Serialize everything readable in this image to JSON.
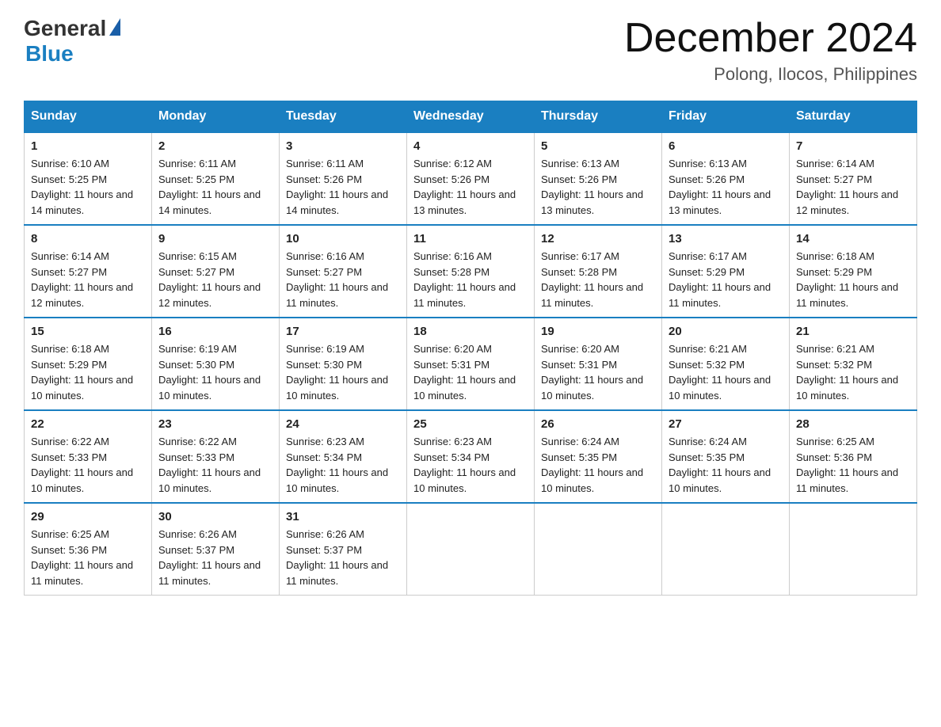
{
  "header": {
    "logo_general": "General",
    "logo_blue": "Blue",
    "month": "December 2024",
    "location": "Polong, Ilocos, Philippines"
  },
  "days_of_week": [
    "Sunday",
    "Monday",
    "Tuesday",
    "Wednesday",
    "Thursday",
    "Friday",
    "Saturday"
  ],
  "weeks": [
    [
      {
        "day": "1",
        "sunrise": "6:10 AM",
        "sunset": "5:25 PM",
        "daylight": "11 hours and 14 minutes."
      },
      {
        "day": "2",
        "sunrise": "6:11 AM",
        "sunset": "5:25 PM",
        "daylight": "11 hours and 14 minutes."
      },
      {
        "day": "3",
        "sunrise": "6:11 AM",
        "sunset": "5:26 PM",
        "daylight": "11 hours and 14 minutes."
      },
      {
        "day": "4",
        "sunrise": "6:12 AM",
        "sunset": "5:26 PM",
        "daylight": "11 hours and 13 minutes."
      },
      {
        "day": "5",
        "sunrise": "6:13 AM",
        "sunset": "5:26 PM",
        "daylight": "11 hours and 13 minutes."
      },
      {
        "day": "6",
        "sunrise": "6:13 AM",
        "sunset": "5:26 PM",
        "daylight": "11 hours and 13 minutes."
      },
      {
        "day": "7",
        "sunrise": "6:14 AM",
        "sunset": "5:27 PM",
        "daylight": "11 hours and 12 minutes."
      }
    ],
    [
      {
        "day": "8",
        "sunrise": "6:14 AM",
        "sunset": "5:27 PM",
        "daylight": "11 hours and 12 minutes."
      },
      {
        "day": "9",
        "sunrise": "6:15 AM",
        "sunset": "5:27 PM",
        "daylight": "11 hours and 12 minutes."
      },
      {
        "day": "10",
        "sunrise": "6:16 AM",
        "sunset": "5:27 PM",
        "daylight": "11 hours and 11 minutes."
      },
      {
        "day": "11",
        "sunrise": "6:16 AM",
        "sunset": "5:28 PM",
        "daylight": "11 hours and 11 minutes."
      },
      {
        "day": "12",
        "sunrise": "6:17 AM",
        "sunset": "5:28 PM",
        "daylight": "11 hours and 11 minutes."
      },
      {
        "day": "13",
        "sunrise": "6:17 AM",
        "sunset": "5:29 PM",
        "daylight": "11 hours and 11 minutes."
      },
      {
        "day": "14",
        "sunrise": "6:18 AM",
        "sunset": "5:29 PM",
        "daylight": "11 hours and 11 minutes."
      }
    ],
    [
      {
        "day": "15",
        "sunrise": "6:18 AM",
        "sunset": "5:29 PM",
        "daylight": "11 hours and 10 minutes."
      },
      {
        "day": "16",
        "sunrise": "6:19 AM",
        "sunset": "5:30 PM",
        "daylight": "11 hours and 10 minutes."
      },
      {
        "day": "17",
        "sunrise": "6:19 AM",
        "sunset": "5:30 PM",
        "daylight": "11 hours and 10 minutes."
      },
      {
        "day": "18",
        "sunrise": "6:20 AM",
        "sunset": "5:31 PM",
        "daylight": "11 hours and 10 minutes."
      },
      {
        "day": "19",
        "sunrise": "6:20 AM",
        "sunset": "5:31 PM",
        "daylight": "11 hours and 10 minutes."
      },
      {
        "day": "20",
        "sunrise": "6:21 AM",
        "sunset": "5:32 PM",
        "daylight": "11 hours and 10 minutes."
      },
      {
        "day": "21",
        "sunrise": "6:21 AM",
        "sunset": "5:32 PM",
        "daylight": "11 hours and 10 minutes."
      }
    ],
    [
      {
        "day": "22",
        "sunrise": "6:22 AM",
        "sunset": "5:33 PM",
        "daylight": "11 hours and 10 minutes."
      },
      {
        "day": "23",
        "sunrise": "6:22 AM",
        "sunset": "5:33 PM",
        "daylight": "11 hours and 10 minutes."
      },
      {
        "day": "24",
        "sunrise": "6:23 AM",
        "sunset": "5:34 PM",
        "daylight": "11 hours and 10 minutes."
      },
      {
        "day": "25",
        "sunrise": "6:23 AM",
        "sunset": "5:34 PM",
        "daylight": "11 hours and 10 minutes."
      },
      {
        "day": "26",
        "sunrise": "6:24 AM",
        "sunset": "5:35 PM",
        "daylight": "11 hours and 10 minutes."
      },
      {
        "day": "27",
        "sunrise": "6:24 AM",
        "sunset": "5:35 PM",
        "daylight": "11 hours and 10 minutes."
      },
      {
        "day": "28",
        "sunrise": "6:25 AM",
        "sunset": "5:36 PM",
        "daylight": "11 hours and 11 minutes."
      }
    ],
    [
      {
        "day": "29",
        "sunrise": "6:25 AM",
        "sunset": "5:36 PM",
        "daylight": "11 hours and 11 minutes."
      },
      {
        "day": "30",
        "sunrise": "6:26 AM",
        "sunset": "5:37 PM",
        "daylight": "11 hours and 11 minutes."
      },
      {
        "day": "31",
        "sunrise": "6:26 AM",
        "sunset": "5:37 PM",
        "daylight": "11 hours and 11 minutes."
      },
      null,
      null,
      null,
      null
    ]
  ]
}
